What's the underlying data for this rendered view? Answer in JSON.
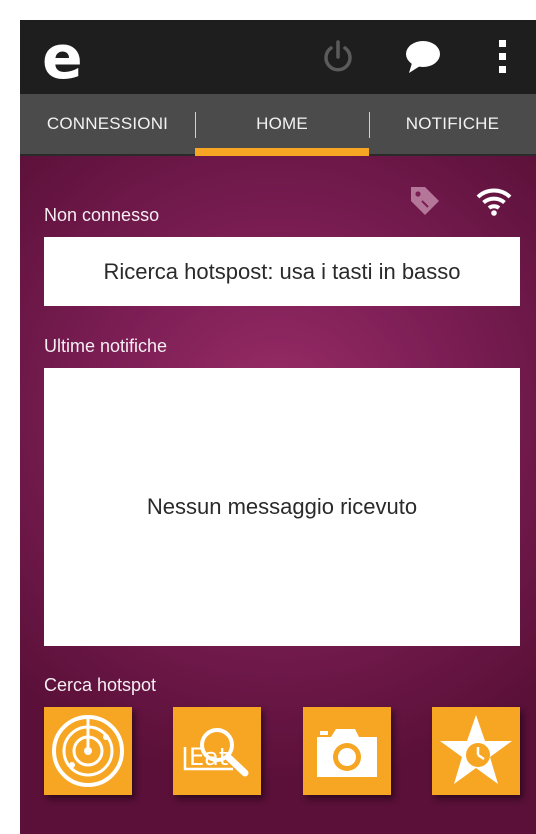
{
  "app": {
    "logo_letter": "e"
  },
  "actionbar": {
    "icons": [
      "power-icon",
      "chat-bubble-icon",
      "overflow-menu-icon"
    ]
  },
  "tabs": [
    {
      "label": "CONNESSIONI",
      "selected": false
    },
    {
      "label": "HOME",
      "selected": true
    },
    {
      "label": "NOTIFICHE",
      "selected": false
    }
  ],
  "status": {
    "connection_label": "Non connesso",
    "hotspot_message": "Ricerca hotspost: usa i tasti in basso",
    "icons": [
      "tag-icon",
      "wifi-icon"
    ]
  },
  "notifications": {
    "title": "Ultime notifiche",
    "empty_message": "Nessun messaggio ricevuto"
  },
  "search": {
    "title": "Cerca hotspot",
    "buttons": [
      {
        "icon": "radar-icon"
      },
      {
        "icon": "eat-search-icon",
        "text": "Eat"
      },
      {
        "icon": "camera-icon"
      },
      {
        "icon": "star-clock-icon"
      }
    ]
  },
  "colors": {
    "actionbar": "#1e1e1e",
    "tabbar": "#4b4b4b",
    "accent": "#f6a623",
    "background": "#7c1e55"
  }
}
